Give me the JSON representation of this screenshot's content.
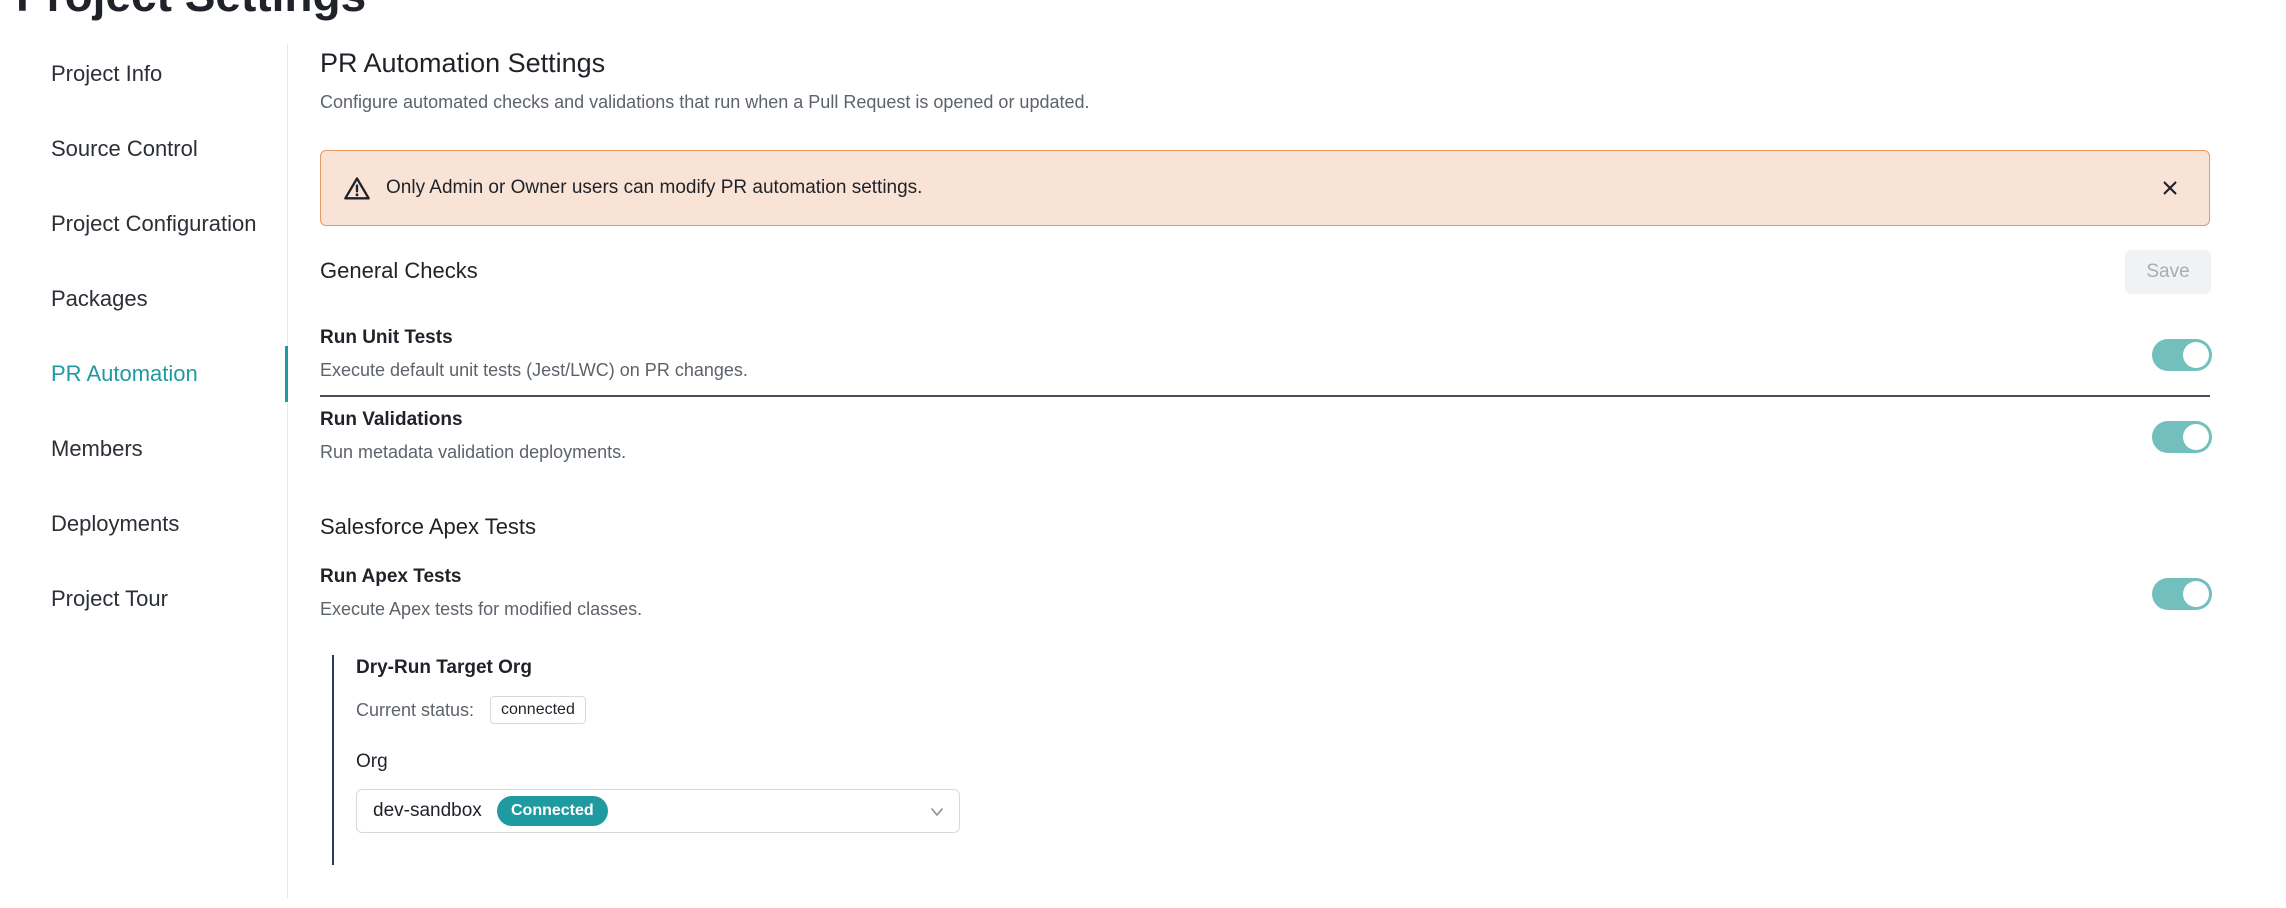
{
  "page": {
    "title": "Project Settings"
  },
  "sidebar": {
    "items": [
      {
        "label": "Project Info",
        "active": false
      },
      {
        "label": "Source Control",
        "active": false
      },
      {
        "label": "Project Configuration",
        "active": false
      },
      {
        "label": "Packages",
        "active": false
      },
      {
        "label": "PR Automation",
        "active": true
      },
      {
        "label": "Members",
        "active": false
      },
      {
        "label": "Deployments",
        "active": false
      },
      {
        "label": "Project Tour",
        "active": false
      }
    ]
  },
  "main": {
    "heading": "PR Automation Settings",
    "description": "Configure automated checks and validations that run when a Pull Request is opened or updated.",
    "alert": {
      "text": "Only Admin or Owner users can modify PR automation settings.",
      "icon": "warning-triangle-icon",
      "close_icon": "close-icon",
      "background": "#f9e3d6",
      "border": "#e79b5f"
    },
    "general": {
      "heading": "General Checks",
      "save_label": "Save",
      "settings": [
        {
          "title": "Run Unit Tests",
          "description": "Execute default unit tests (Jest/LWC) on PR changes.",
          "enabled": true
        },
        {
          "title": "Run Validations",
          "description": "Run metadata validation deployments.",
          "enabled": true
        }
      ]
    },
    "apex": {
      "heading": "Salesforce Apex Tests",
      "setting": {
        "title": "Run Apex Tests",
        "description": "Execute Apex tests for modified classes.",
        "enabled": true
      },
      "dry_run": {
        "title": "Dry-Run Target Org",
        "status_label": "Current status:",
        "status_value": "connected",
        "org_label": "Org",
        "org_value": "dev-sandbox",
        "org_badge": "Connected"
      }
    }
  },
  "colors": {
    "accent": "#1f9aa0",
    "toggle_on": "#73bfbd"
  }
}
